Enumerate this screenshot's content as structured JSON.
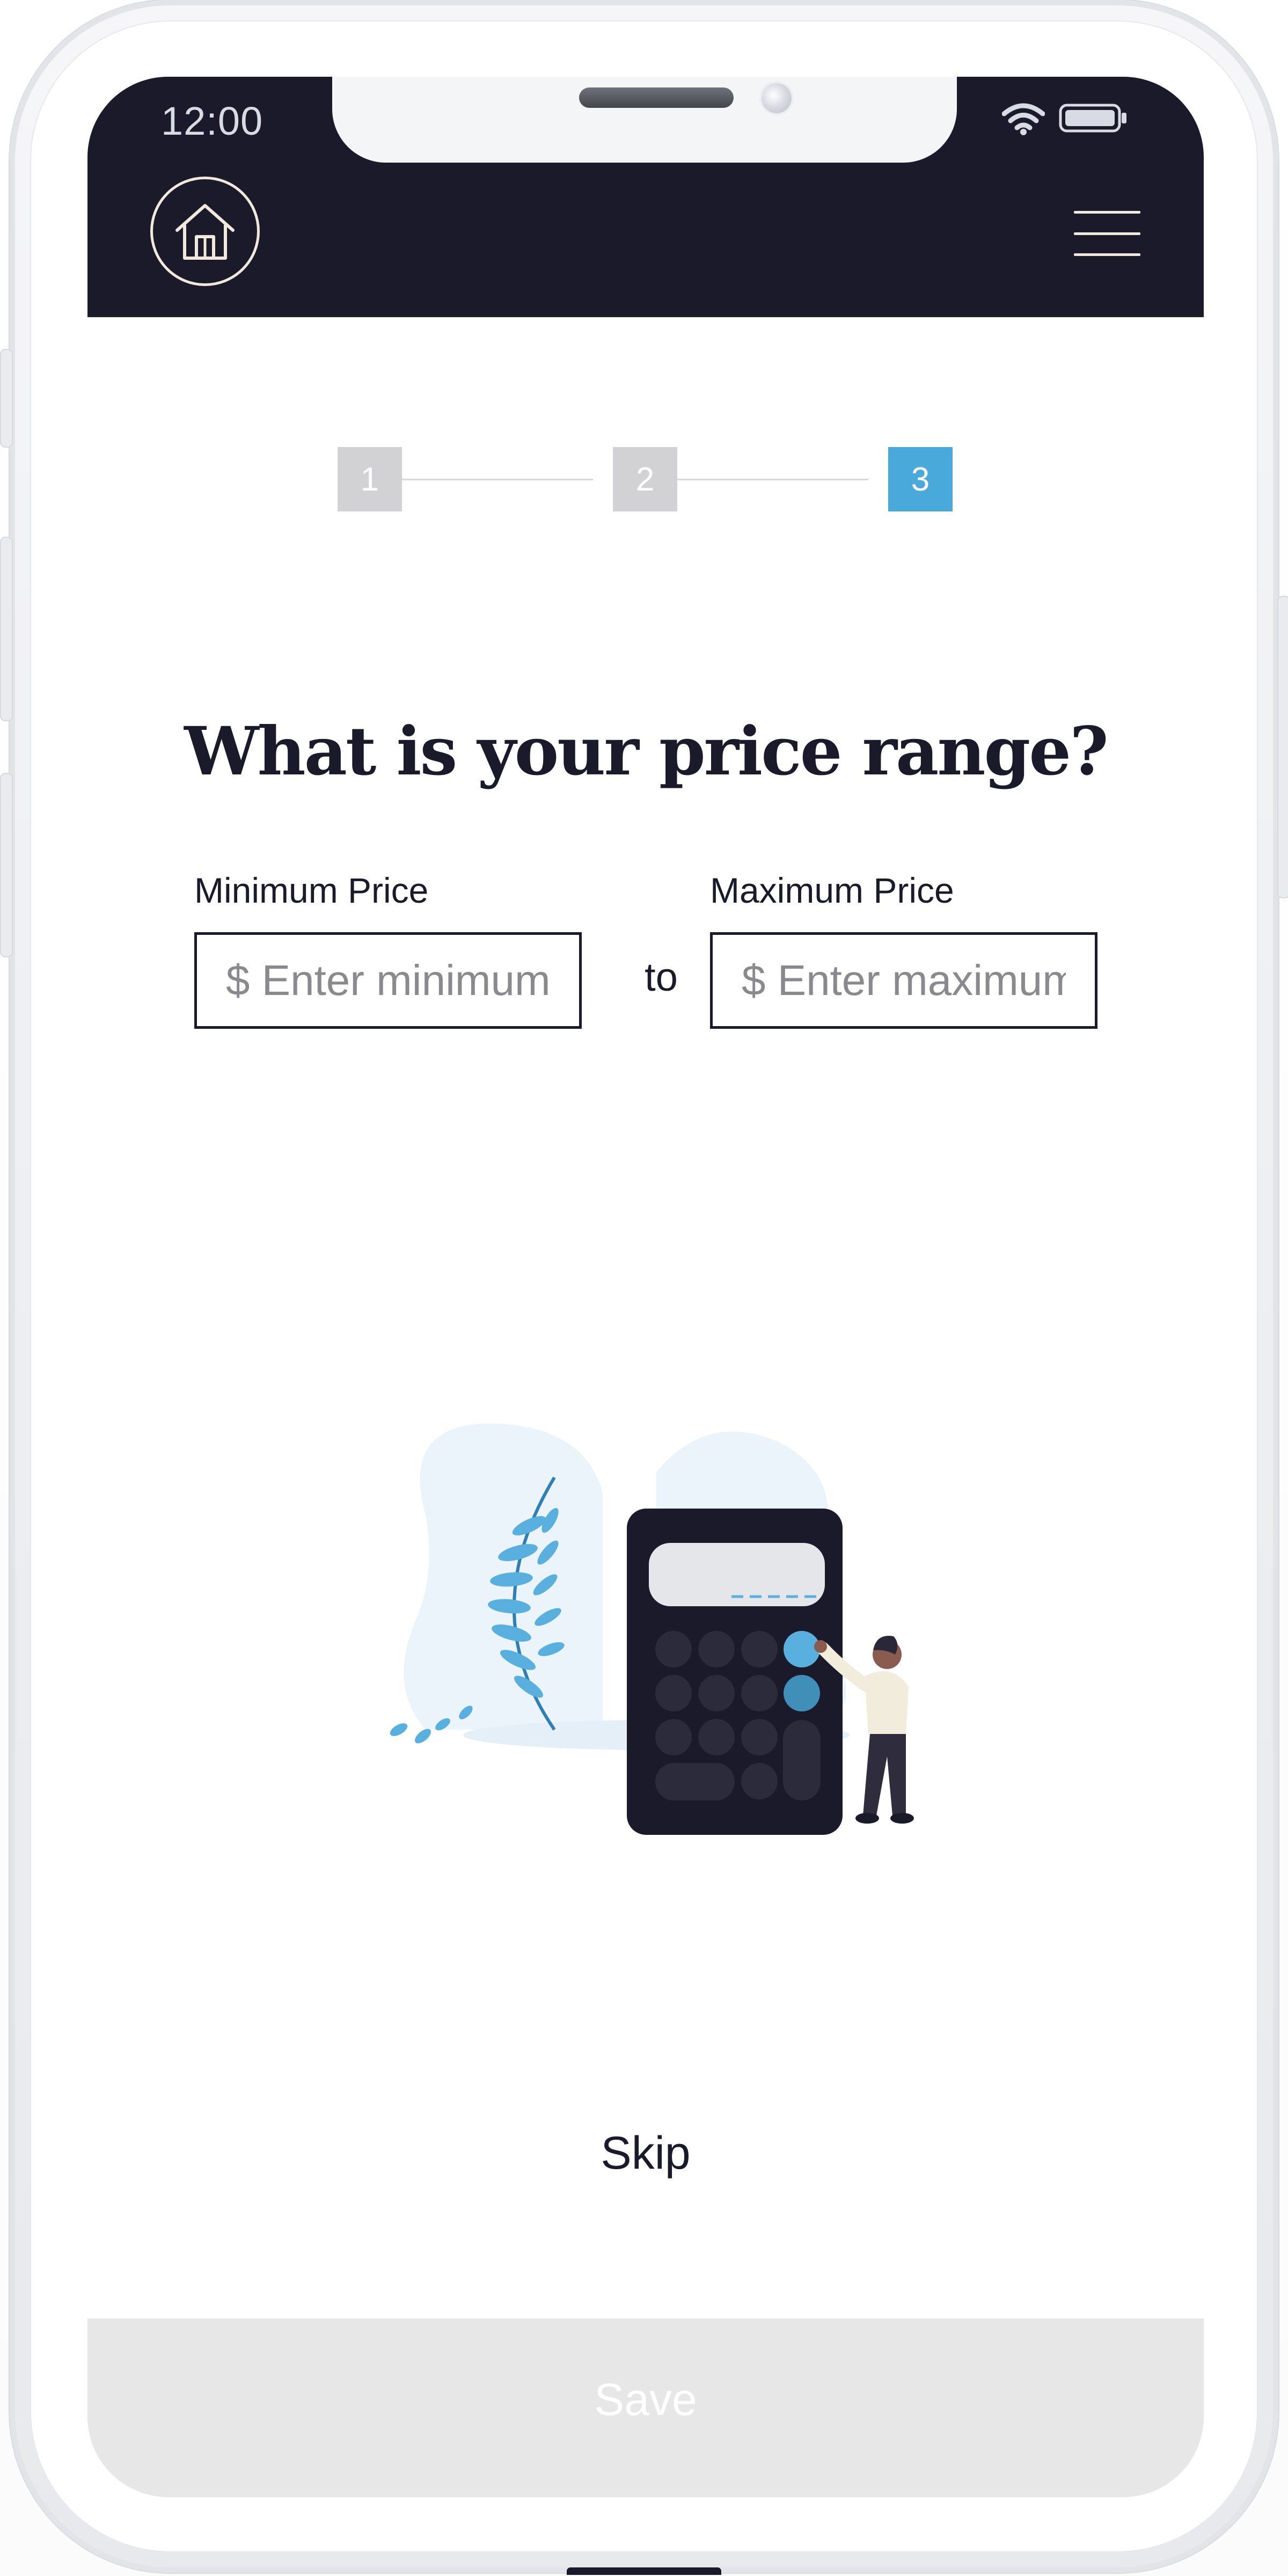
{
  "status_bar": {
    "time": "12:00",
    "wifi_icon": "wifi-icon",
    "battery_icon": "battery-icon"
  },
  "header": {
    "home_icon": "home-icon",
    "menu_icon": "hamburger-menu-icon",
    "background_color": "#1b1a2a"
  },
  "stepper": {
    "steps": [
      {
        "label": "1",
        "state": "inactive"
      },
      {
        "label": "2",
        "state": "inactive"
      },
      {
        "label": "3",
        "state": "active"
      }
    ],
    "active_color": "#48a9da",
    "inactive_color": "#d2d2d4"
  },
  "question": "What is your price range?",
  "price_form": {
    "min_label": "Minimum Price",
    "min_placeholder": "$ Enter minimum",
    "min_value": "",
    "separator": "to",
    "max_label": "Maximum Price",
    "max_placeholder": "$ Enter maximum",
    "max_value": ""
  },
  "illustration": {
    "icon": "person-with-calculator-illustration"
  },
  "skip_label": "Skip",
  "save_label": "Save"
}
